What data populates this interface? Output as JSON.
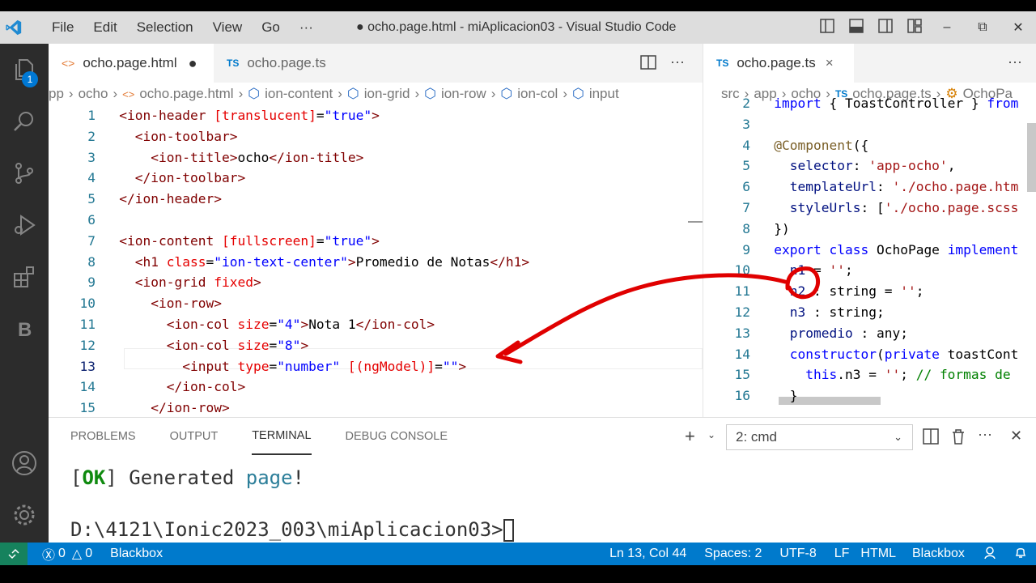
{
  "titlebar": {
    "menu": [
      "File",
      "Edit",
      "Selection",
      "View",
      "Go",
      "···"
    ],
    "title": "● ocho.page.html - miAplicacion03 - Visual Studio Code"
  },
  "activity": {
    "badge": "1"
  },
  "left_editor": {
    "tabs": [
      {
        "label": "ocho.page.html",
        "icon": "<>",
        "dirty": "●"
      },
      {
        "label": "ocho.page.ts",
        "icon": "TS"
      }
    ],
    "breadcrumb": [
      "pp",
      "ocho",
      "ocho.page.html",
      "ion-content",
      "ion-grid",
      "ion-row",
      "ion-col",
      "input"
    ],
    "lines": [
      {
        "n": "1",
        "code": [
          [
            "t",
            "<ion-header "
          ],
          [
            "a",
            "[translucent]"
          ],
          [
            "tx",
            "="
          ],
          [
            "s",
            "\"true\""
          ],
          [
            "t",
            ">"
          ]
        ]
      },
      {
        "n": "2",
        "code": [
          [
            "tx",
            "  "
          ],
          [
            "t",
            "<ion-toolbar>"
          ]
        ]
      },
      {
        "n": "3",
        "code": [
          [
            "tx",
            "    "
          ],
          [
            "t",
            "<ion-title>"
          ],
          [
            "tx",
            "ocho"
          ],
          [
            "t",
            "</ion-title>"
          ]
        ]
      },
      {
        "n": "4",
        "code": [
          [
            "tx",
            "  "
          ],
          [
            "t",
            "</ion-toolbar>"
          ]
        ]
      },
      {
        "n": "5",
        "code": [
          [
            "t",
            "</ion-header>"
          ]
        ]
      },
      {
        "n": "6",
        "code": []
      },
      {
        "n": "7",
        "code": [
          [
            "t",
            "<ion-content "
          ],
          [
            "a",
            "[fullscreen]"
          ],
          [
            "tx",
            "="
          ],
          [
            "s",
            "\"true\""
          ],
          [
            "t",
            ">"
          ]
        ]
      },
      {
        "n": "8",
        "code": [
          [
            "tx",
            "  "
          ],
          [
            "t",
            "<h1 "
          ],
          [
            "a",
            "class"
          ],
          [
            "tx",
            "="
          ],
          [
            "s",
            "\"ion-text-center\""
          ],
          [
            "t",
            ">"
          ],
          [
            "tx",
            "Promedio de Notas"
          ],
          [
            "t",
            "</h1>"
          ]
        ]
      },
      {
        "n": "9",
        "code": [
          [
            "tx",
            "  "
          ],
          [
            "t",
            "<ion-grid "
          ],
          [
            "a",
            "fixed"
          ],
          [
            "t",
            ">"
          ]
        ]
      },
      {
        "n": "10",
        "code": [
          [
            "tx",
            "    "
          ],
          [
            "t",
            "<ion-row>"
          ]
        ]
      },
      {
        "n": "11",
        "code": [
          [
            "tx",
            "      "
          ],
          [
            "t",
            "<ion-col "
          ],
          [
            "a",
            "size"
          ],
          [
            "tx",
            "="
          ],
          [
            "s",
            "\"4\""
          ],
          [
            "t",
            ">"
          ],
          [
            "tx",
            "Nota 1"
          ],
          [
            "t",
            "</ion-col>"
          ]
        ]
      },
      {
        "n": "12",
        "code": [
          [
            "tx",
            "      "
          ],
          [
            "t",
            "<ion-col "
          ],
          [
            "a",
            "size"
          ],
          [
            "tx",
            "="
          ],
          [
            "s",
            "\"8\""
          ],
          [
            "t",
            ">"
          ]
        ]
      },
      {
        "n": "13",
        "code": [
          [
            "tx",
            "        "
          ],
          [
            "t",
            "<input "
          ],
          [
            "a",
            "type"
          ],
          [
            "tx",
            "="
          ],
          [
            "s",
            "\"number\""
          ],
          [
            "tx",
            " "
          ],
          [
            "a",
            "[(ngModel)]"
          ],
          [
            "tx",
            "="
          ],
          [
            "s",
            "\"\""
          ],
          [
            "t",
            ">"
          ]
        ]
      },
      {
        "n": "14",
        "code": [
          [
            "tx",
            "      "
          ],
          [
            "t",
            "</ion-col>"
          ]
        ]
      },
      {
        "n": "15",
        "code": [
          [
            "tx",
            "    "
          ],
          [
            "t",
            "</ion-row>"
          ]
        ]
      }
    ]
  },
  "right_editor": {
    "tabs": [
      {
        "label": "ocho.page.ts",
        "icon": "TS",
        "close": "×"
      }
    ],
    "breadcrumb": [
      "src",
      "app",
      "ocho",
      "ocho.page.ts",
      "OchoPa"
    ],
    "lines": [
      {
        "n": "2",
        "code": [
          [
            "k",
            "import"
          ],
          [
            "tx",
            " { ToastController } "
          ],
          [
            "k",
            "from"
          ]
        ]
      },
      {
        "n": "3",
        "code": []
      },
      {
        "n": "4",
        "code": [
          [
            "fn",
            "@Component"
          ],
          [
            "tx",
            "({"
          ]
        ]
      },
      {
        "n": "5",
        "code": [
          [
            "tx",
            "  "
          ],
          [
            "v",
            "selector"
          ],
          [
            "tx",
            ": "
          ],
          [
            "st",
            "'app-ocho'"
          ],
          [
            "tx",
            ","
          ]
        ]
      },
      {
        "n": "6",
        "code": [
          [
            "tx",
            "  "
          ],
          [
            "v",
            "templateUrl"
          ],
          [
            "tx",
            ": "
          ],
          [
            "st",
            "'./ocho.page.htm"
          ]
        ]
      },
      {
        "n": "7",
        "code": [
          [
            "tx",
            "  "
          ],
          [
            "v",
            "styleUrls"
          ],
          [
            "tx",
            ": ["
          ],
          [
            "st",
            "'./ocho.page.scss"
          ]
        ]
      },
      {
        "n": "8",
        "code": [
          [
            "tx",
            "})"
          ]
        ]
      },
      {
        "n": "9",
        "code": [
          [
            "k",
            "export"
          ],
          [
            "tx",
            " "
          ],
          [
            "k",
            "class"
          ],
          [
            "tx",
            " OchoPage "
          ],
          [
            "k",
            "implement"
          ]
        ]
      },
      {
        "n": "10",
        "code": [
          [
            "tx",
            "  "
          ],
          [
            "v",
            "n1"
          ],
          [
            "tx",
            " = "
          ],
          [
            "st",
            "''"
          ],
          [
            "tx",
            ";"
          ]
        ]
      },
      {
        "n": "11",
        "code": [
          [
            "tx",
            "  "
          ],
          [
            "v",
            "n2"
          ],
          [
            "tx",
            " : string = "
          ],
          [
            "st",
            "''"
          ],
          [
            "tx",
            ";"
          ]
        ]
      },
      {
        "n": "12",
        "code": [
          [
            "tx",
            "  "
          ],
          [
            "v",
            "n3"
          ],
          [
            "tx",
            " : string;"
          ]
        ]
      },
      {
        "n": "13",
        "code": [
          [
            "tx",
            "  "
          ],
          [
            "v",
            "promedio"
          ],
          [
            "tx",
            " : any;"
          ]
        ]
      },
      {
        "n": "14",
        "code": [
          [
            "tx",
            "  "
          ],
          [
            "k",
            "constructor"
          ],
          [
            "tx",
            "("
          ],
          [
            "k",
            "private"
          ],
          [
            "tx",
            " toastCont"
          ]
        ]
      },
      {
        "n": "15",
        "code": [
          [
            "tx",
            "    "
          ],
          [
            "k",
            "this"
          ],
          [
            "tx",
            ".n3 = "
          ],
          [
            "st",
            "''"
          ],
          [
            "tx",
            "; "
          ],
          [
            "c",
            "// formas de"
          ]
        ]
      },
      {
        "n": "16",
        "code": [
          [
            "tx",
            "  }"
          ]
        ]
      }
    ]
  },
  "panel": {
    "tabs": [
      "PROBLEMS",
      "OUTPUT",
      "TERMINAL",
      "DEBUG CONSOLE"
    ],
    "terminal_select": "2: cmd",
    "terminal": {
      "line1_open": "[",
      "line1_ok": "OK",
      "line1_close": "] Generated ",
      "line1_word": "page",
      "line1_end": "!",
      "prompt": "D:\\4121\\Ionic2023_003\\miAplicacion03>"
    }
  },
  "statusbar": {
    "errors": "0",
    "warnings": "0",
    "left_label": "Blackbox",
    "position": "Ln 13, Col 44",
    "spaces": "Spaces: 2",
    "encoding": "UTF-8",
    "eol": "LF",
    "language": "HTML",
    "right_label": "Blackbox"
  },
  "colors": {
    "status_bg": "#007acc",
    "remote_bg": "#16825d",
    "activity_bg": "#2c2c2c",
    "annotation": "#e00000"
  }
}
